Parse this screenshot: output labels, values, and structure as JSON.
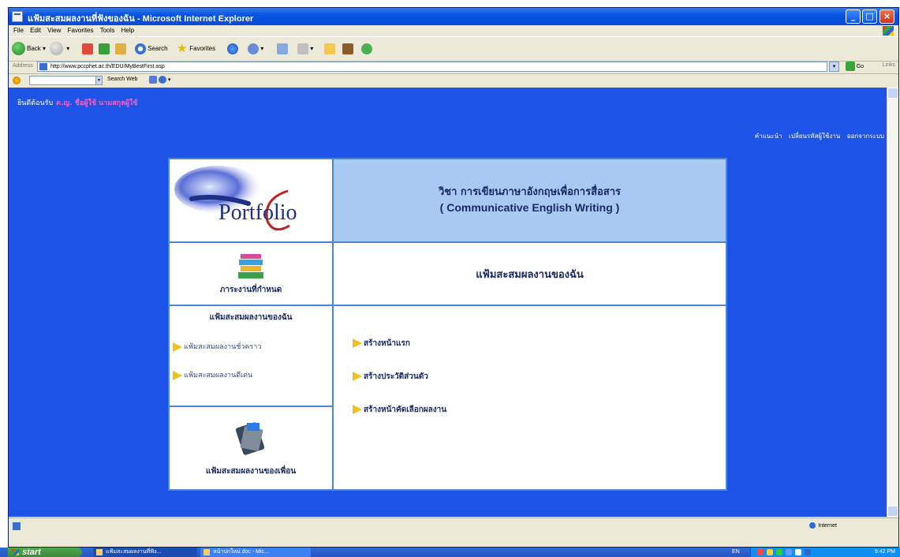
{
  "window": {
    "title": "แฟ้มสะสมผลงานที่ฟังของฉัน - Microsoft Internet Explorer",
    "menu": [
      "File",
      "Edit",
      "View",
      "Favorites",
      "Tools",
      "Help"
    ],
    "toolbar": {
      "back": "Back",
      "search": "Search",
      "favorites": "Favorites"
    },
    "address_label": "Address",
    "url": "http://www.pccphet.ac.th/EDU/MyBestFirst.asp",
    "go_label": "Go",
    "links_label": "Links",
    "search_button": "Search Web"
  },
  "page": {
    "welcome": "ยินดีต้อนรับ",
    "username": "ด.ญ. ชื่อผู้ใช้ นามสกุลผู้ใช้",
    "top_links": [
      "คำแนะนำ",
      "เปลี่ยนรหัสผู้ใช้งาน",
      "ออกจากระบบ"
    ],
    "logo_text": "Portfolio",
    "course_title_th": "วิชา การเขียนภาษาอังกฤษเพื่อการสื่อสาร",
    "course_title_en": "( Communicative English Writing )",
    "assignment_label": "ภาระงานที่กำหนด",
    "my_portfolio_title": "แฟ้มสะสมผลงานของฉัน",
    "left_menu": {
      "header": "แฟ้มสะสมผลงานของฉัน",
      "items": [
        "แฟ้มสะสมผลงานชั่วคราว",
        "แฟ้มสะสมผลงานดีเด่น"
      ]
    },
    "right_menu": [
      "สร้างหน้าแรก",
      "สร้างประวัติส่วนตัว",
      "สร้างหน้าคัดเลือกผลงาน"
    ],
    "friends_label": "แฟ้มสะสมผลงานของเพื่อน"
  },
  "statusbar": {
    "zone": "Internet"
  },
  "taskbar": {
    "start": "start",
    "tasks": [
      "แฟ้มสะสมผลงานที่ฟัง...",
      "หน้าปกใหม่.doc - Mic..."
    ],
    "lang": "EN",
    "clock": "9:42 PM"
  },
  "colors": {
    "page_background": "#1e53e8",
    "course_header": "#a8c9f2",
    "username": "#ff5fc4",
    "arrow": "#f0c020"
  },
  "icons": [
    "ie-page-icon",
    "back-icon",
    "forward-icon",
    "stop-icon",
    "refresh-icon",
    "home-icon",
    "search-icon",
    "favorites-icon",
    "media-icon",
    "mail-icon",
    "print-icon",
    "windows-logo-icon",
    "go-icon",
    "books-icon",
    "portfolio-binder-icon",
    "yellow-arrow-icon"
  ]
}
